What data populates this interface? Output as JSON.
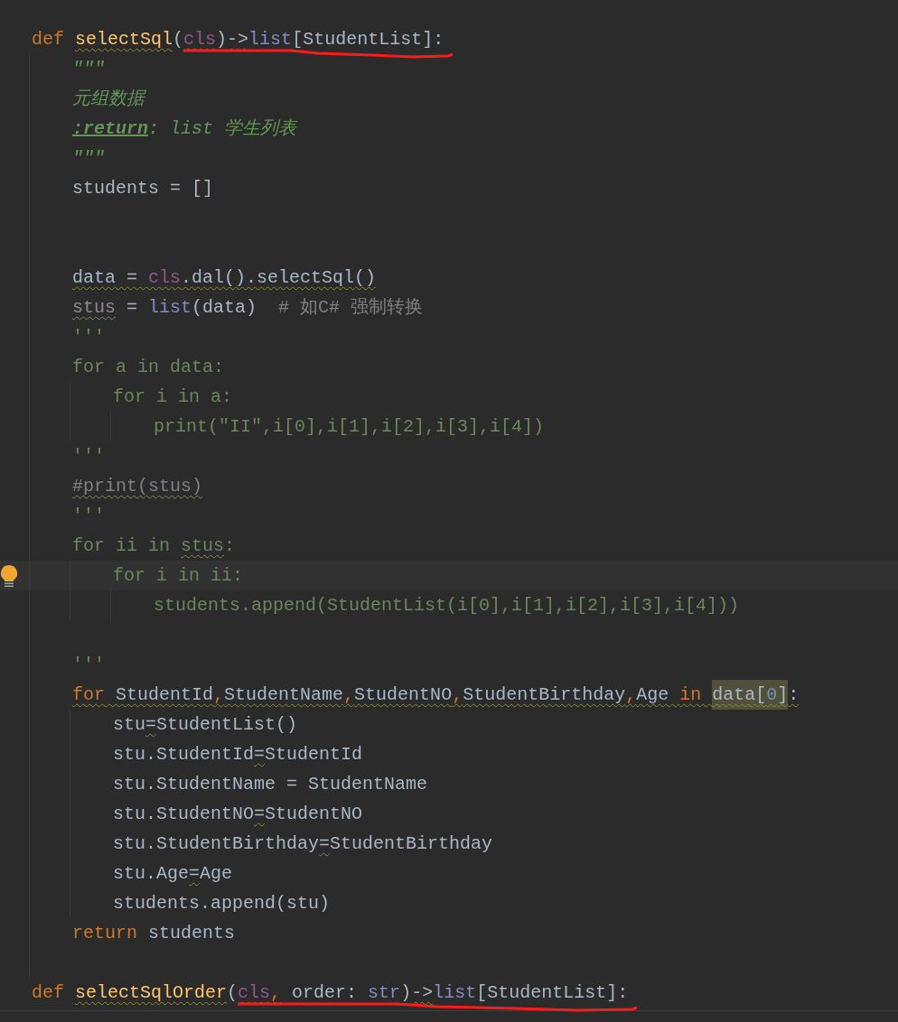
{
  "editor": {
    "lines": [
      {
        "marked": true,
        "tokens": [
          {
            "text": "def ",
            "kind": "kw",
            "warn": false
          },
          {
            "text": "selectSql",
            "kind": "fn",
            "warn": true
          },
          {
            "text": "(",
            "kind": "plain",
            "warn": false
          },
          {
            "text": "cls",
            "kind": "param",
            "warn": true
          },
          {
            "text": ")",
            "kind": "plain",
            "warn": false
          },
          {
            "text": "->",
            "kind": "plain",
            "warn": true
          },
          {
            "text": "list",
            "kind": "builtin",
            "warn": false
          },
          {
            "text": "[StudentList]:",
            "kind": "plain",
            "warn": false
          }
        ]
      },
      {
        "marked": false,
        "tokens": [
          {
            "text": "    \"\"\"",
            "kind": "doc",
            "warn": false
          }
        ]
      },
      {
        "marked": false,
        "tokens": [
          {
            "text": "    元组数据",
            "kind": "doc",
            "warn": false
          }
        ]
      },
      {
        "marked": false,
        "tokens": [
          {
            "text": "    :return",
            "kind": "doctag",
            "warn": false
          },
          {
            "text": ": list 学生列表",
            "kind": "doc",
            "warn": false
          }
        ]
      },
      {
        "marked": false,
        "tokens": [
          {
            "text": "    \"\"\"",
            "kind": "doc",
            "warn": false
          }
        ]
      },
      {
        "marked": false,
        "tokens": [
          {
            "text": "    students = []",
            "kind": "plain",
            "warn": false
          }
        ]
      },
      {
        "kind": "blank"
      },
      {
        "kind": "blank"
      },
      {
        "marked": false,
        "tokens": [
          {
            "text": "    data = ",
            "kind": "plain",
            "warn": true
          },
          {
            "text": "cls",
            "kind": "param",
            "warn": true
          },
          {
            "text": ".dal().selectSql()",
            "kind": "plain",
            "warn": true
          }
        ]
      },
      {
        "marked": false,
        "tokens": [
          {
            "text": "    stus",
            "kind": "unused",
            "warn": true
          },
          {
            "text": " = ",
            "kind": "plain",
            "warn": false
          },
          {
            "text": "list",
            "kind": "builtin",
            "warn": false
          },
          {
            "text": "(data)",
            "kind": "plain",
            "warn": false
          },
          {
            "text": "  # 如C# 强制转换",
            "kind": "comment",
            "warn": false
          }
        ]
      },
      {
        "marked": false,
        "tokens": [
          {
            "text": "    '''",
            "kind": "dead",
            "warn": false
          }
        ]
      },
      {
        "marked": false,
        "tokens": [
          {
            "text": "    for a in data:",
            "kind": "dead",
            "warn": false
          }
        ]
      },
      {
        "marked": false,
        "tokens": [
          {
            "text": "        for i in a:",
            "kind": "dead",
            "warn": false
          }
        ]
      },
      {
        "marked": false,
        "tokens": [
          {
            "text": "            print(\"II\",i[0],i[1],i[2],i[3],i[4])",
            "kind": "dead",
            "warn": false
          }
        ]
      },
      {
        "marked": false,
        "tokens": [
          {
            "text": "    '''",
            "kind": "dead",
            "warn": false
          }
        ]
      },
      {
        "marked": false,
        "tokens": [
          {
            "text": "    #print(stus)",
            "kind": "comment",
            "warn": true
          }
        ]
      },
      {
        "marked": false,
        "tokens": [
          {
            "text": "    '''",
            "kind": "dead",
            "warn": false
          }
        ]
      },
      {
        "marked": false,
        "tokens": [
          {
            "text": "    for ii in ",
            "kind": "dead",
            "warn": false
          },
          {
            "text": "stus",
            "kind": "dead",
            "warn": true
          },
          {
            "text": ":",
            "kind": "dead",
            "warn": false
          }
        ]
      },
      {
        "current": true,
        "marked": false,
        "hint": true,
        "tokens": [
          {
            "text": "        for i in ii:",
            "kind": "dead",
            "warn": false
          }
        ]
      },
      {
        "marked": false,
        "tokens": [
          {
            "text": "            students.append(StudentList(i[0],i[1],i[2],i[3],i[4]))",
            "kind": "dead",
            "warn": false
          }
        ]
      },
      {
        "kind": "blank"
      },
      {
        "marked": false,
        "tokens": [
          {
            "text": "    '''",
            "kind": "dead",
            "warn": false
          }
        ]
      },
      {
        "marked": false,
        "tokens": [
          {
            "text": "    for",
            "kind": "kw",
            "warn": true
          },
          {
            "text": " StudentId",
            "kind": "plain",
            "warn": true
          },
          {
            "text": ",",
            "kind": "kw",
            "warn": true
          },
          {
            "text": "StudentName",
            "kind": "plain",
            "warn": true
          },
          {
            "text": ",",
            "kind": "kw",
            "warn": true
          },
          {
            "text": "StudentNO",
            "kind": "plain",
            "warn": true
          },
          {
            "text": ",",
            "kind": "kw",
            "warn": true
          },
          {
            "text": "StudentBirthday",
            "kind": "plain",
            "warn": true
          },
          {
            "text": ",",
            "kind": "kw",
            "warn": true
          },
          {
            "text": "Age ",
            "kind": "plain",
            "warn": true
          },
          {
            "text": "in ",
            "kind": "kw",
            "warn": true
          },
          {
            "text": "data[",
            "kind": "match",
            "warn": true
          },
          {
            "text": "0",
            "kind": "matchnum",
            "warn": true
          },
          {
            "text": "]",
            "kind": "match",
            "warn": true
          },
          {
            "text": ":",
            "kind": "plain",
            "warn": true
          }
        ]
      },
      {
        "marked": false,
        "tokens": [
          {
            "text": "        stu",
            "kind": "plain",
            "warn": false
          },
          {
            "text": "=",
            "kind": "plain",
            "warn": true
          },
          {
            "text": "StudentList()",
            "kind": "plain",
            "warn": false
          }
        ]
      },
      {
        "marked": false,
        "tokens": [
          {
            "text": "        stu.StudentId",
            "kind": "plain",
            "warn": false
          },
          {
            "text": "=",
            "kind": "plain",
            "warn": true
          },
          {
            "text": "StudentId",
            "kind": "plain",
            "warn": false
          }
        ]
      },
      {
        "marked": false,
        "tokens": [
          {
            "text": "        stu.StudentName = StudentName",
            "kind": "plain",
            "warn": false
          }
        ]
      },
      {
        "marked": false,
        "tokens": [
          {
            "text": "        stu.StudentNO",
            "kind": "plain",
            "warn": false
          },
          {
            "text": "=",
            "kind": "plain",
            "warn": true
          },
          {
            "text": "StudentNO",
            "kind": "plain",
            "warn": false
          }
        ]
      },
      {
        "marked": false,
        "tokens": [
          {
            "text": "        stu.StudentBirthday",
            "kind": "plain",
            "warn": false
          },
          {
            "text": "=",
            "kind": "plain",
            "warn": true
          },
          {
            "text": "StudentBirthday",
            "kind": "plain",
            "warn": false
          }
        ]
      },
      {
        "marked": false,
        "tokens": [
          {
            "text": "        stu.Age",
            "kind": "plain",
            "warn": false
          },
          {
            "text": "=",
            "kind": "plain",
            "warn": true
          },
          {
            "text": "Age",
            "kind": "plain",
            "warn": false
          }
        ]
      },
      {
        "marked": false,
        "tokens": [
          {
            "text": "        students.append(stu)",
            "kind": "plain",
            "warn": false
          }
        ]
      },
      {
        "marked": false,
        "tokens": [
          {
            "text": "    return",
            "kind": "kw",
            "warn": false
          },
          {
            "text": " students",
            "kind": "plain",
            "warn": false
          }
        ]
      },
      {
        "kind": "blank"
      },
      {
        "marked": true,
        "tokens": [
          {
            "text": "def ",
            "kind": "kw",
            "warn": false
          },
          {
            "text": "selectSqlOrder",
            "kind": "fn",
            "warn": true
          },
          {
            "text": "(",
            "kind": "plain",
            "warn": false
          },
          {
            "text": "cls",
            "kind": "param",
            "warn": true
          },
          {
            "text": ",",
            "kind": "kw",
            "warn": true
          },
          {
            "text": " order: ",
            "kind": "plain",
            "warn": false
          },
          {
            "text": "str",
            "kind": "builtin",
            "warn": false
          },
          {
            "text": ")",
            "kind": "plain",
            "warn": false
          },
          {
            "text": "->",
            "kind": "plain",
            "warn": true
          },
          {
            "text": "list",
            "kind": "builtin",
            "warn": false
          },
          {
            "text": "[StudentList]:",
            "kind": "plain",
            "warn": false
          }
        ]
      }
    ]
  }
}
